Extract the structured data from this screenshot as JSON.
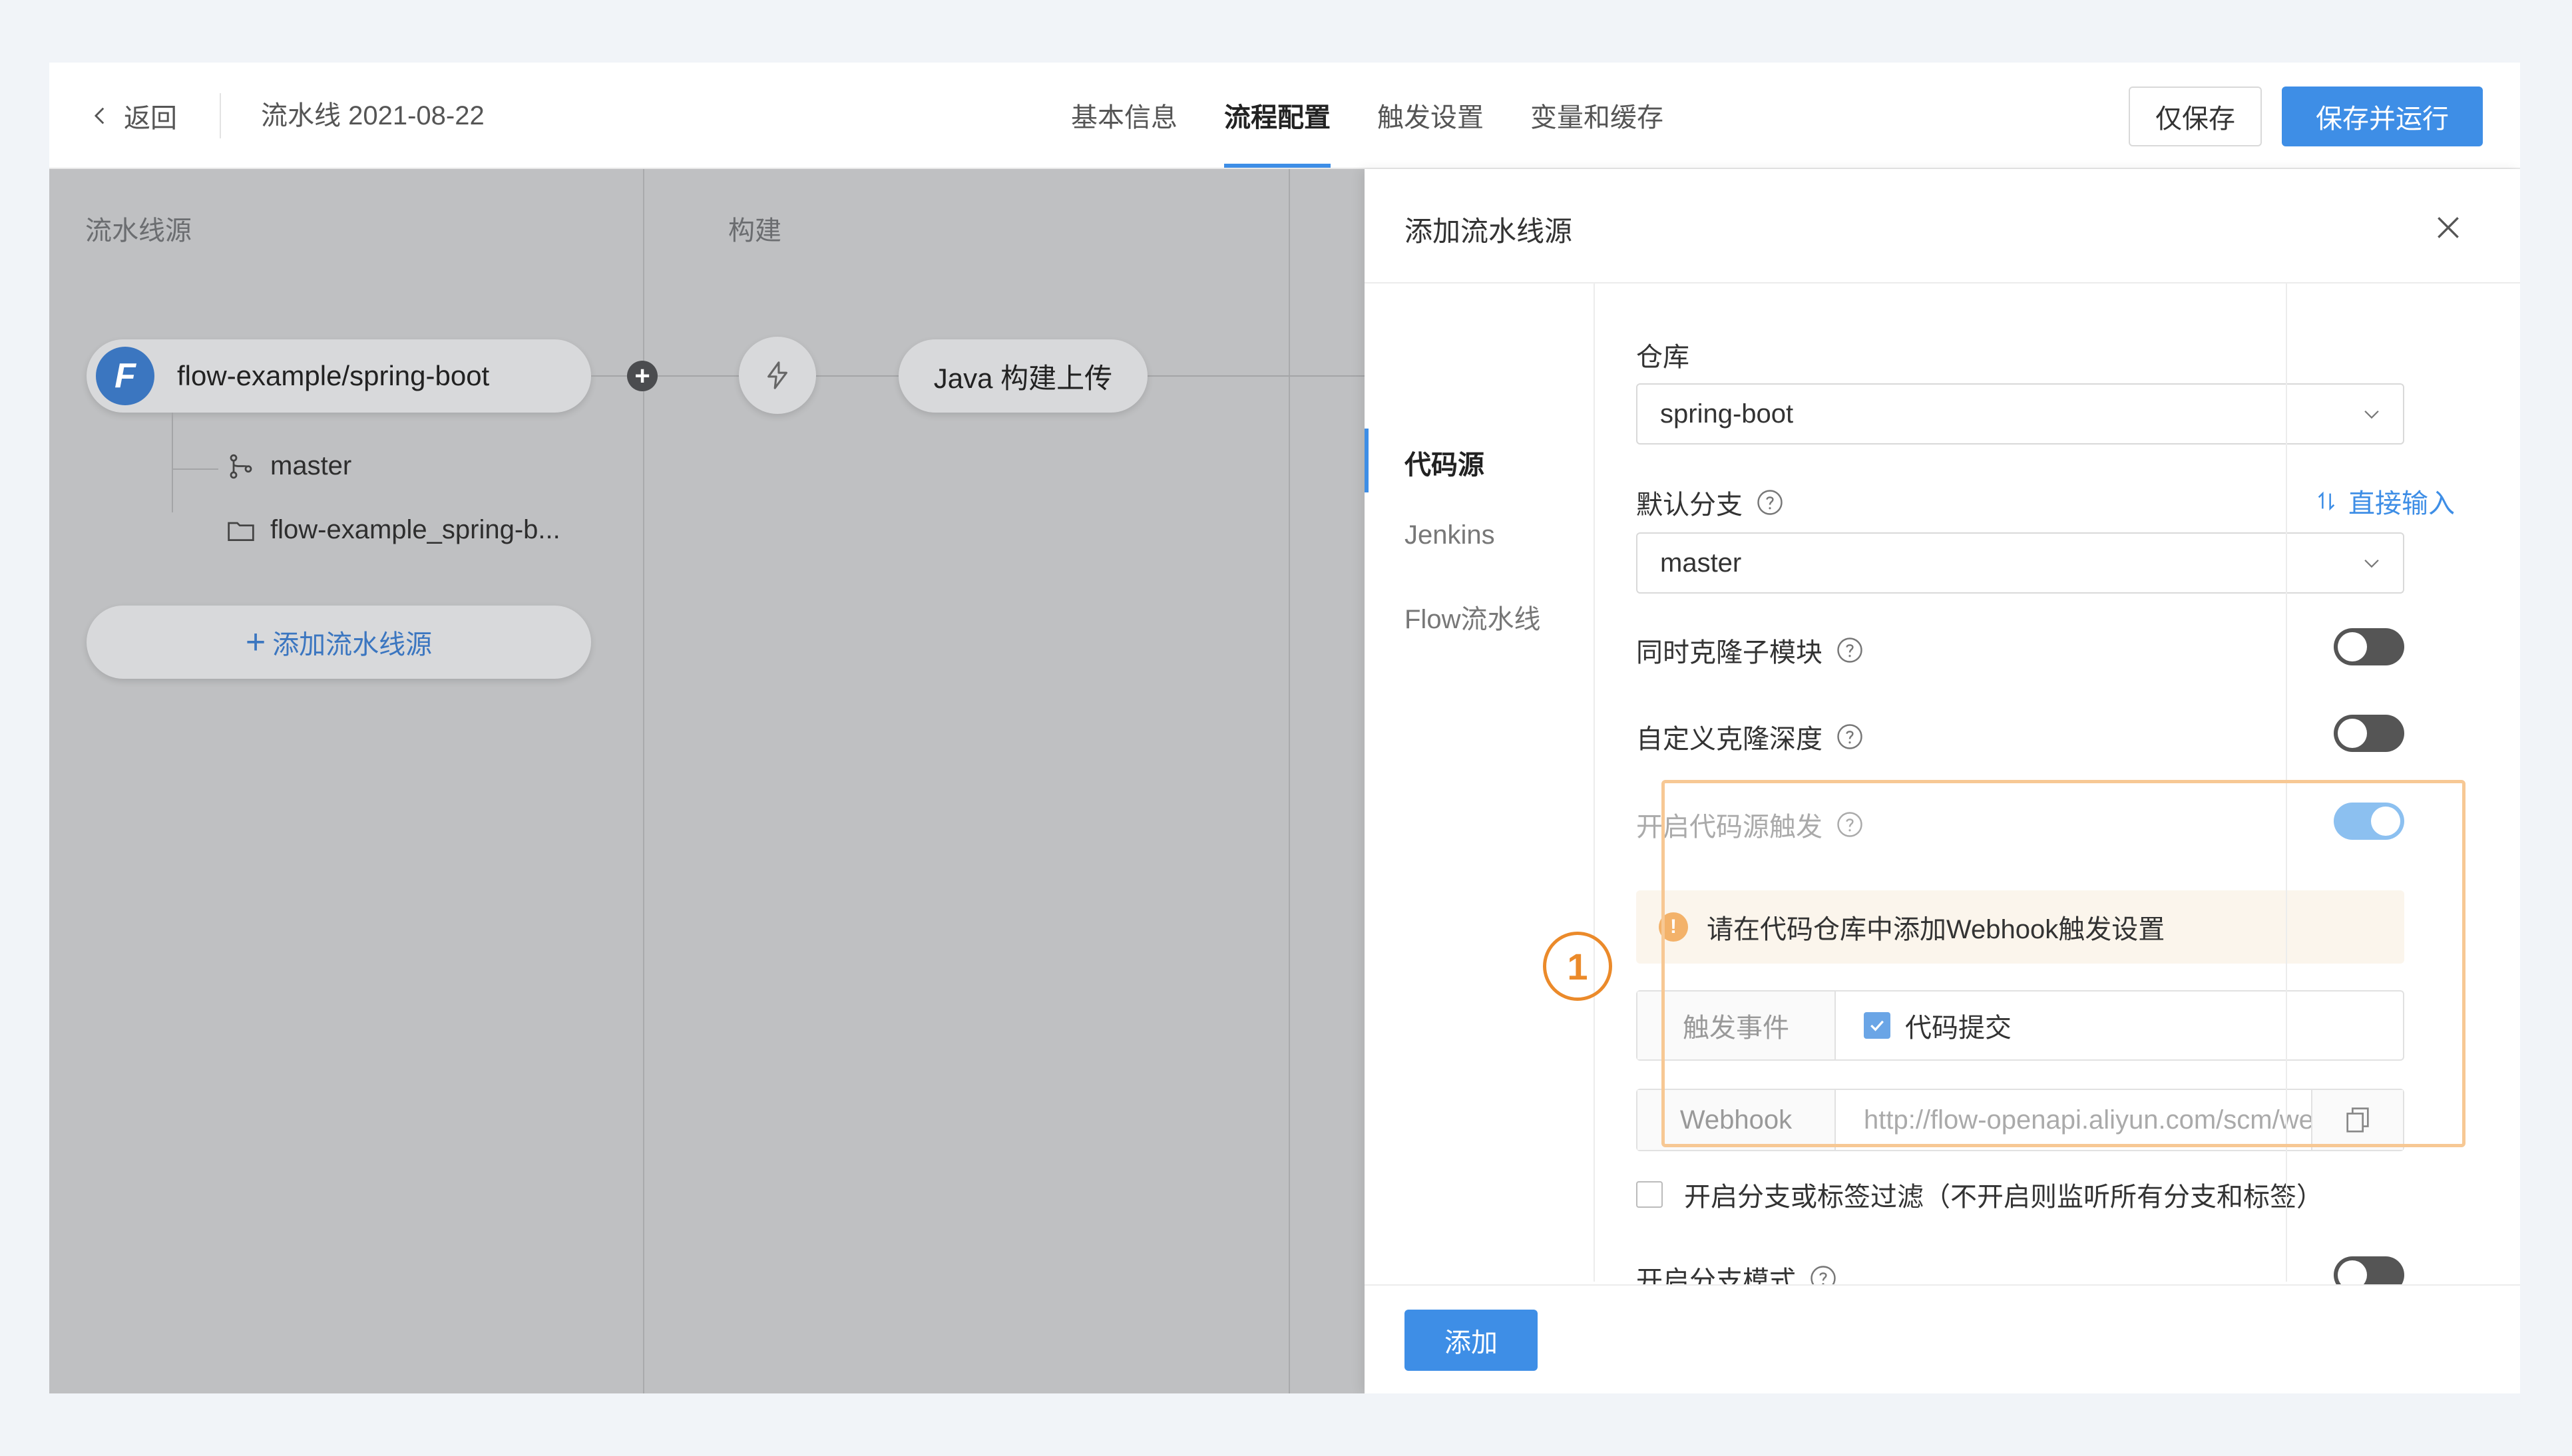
{
  "header": {
    "back_label": "返回",
    "pipeline_title": "流水线 2021-08-22",
    "tabs": [
      {
        "label": "基本信息",
        "active": false
      },
      {
        "label": "流程配置",
        "active": true
      },
      {
        "label": "触发设置",
        "active": false
      },
      {
        "label": "变量和缓存",
        "active": false
      }
    ],
    "save_only_label": "仅保存",
    "save_run_label": "保存并运行"
  },
  "canvas": {
    "columns": [
      "流水线源",
      "构建"
    ],
    "source": {
      "logo_letter": "F",
      "name": "flow-example/spring-boot",
      "branch": "master",
      "path": "flow-example_spring-b..."
    },
    "add_source_label": "添加流水线源",
    "add_source_plus": "+",
    "plus_dot": "+",
    "job_label": "Java 构建上传"
  },
  "drawer": {
    "title": "添加流水线源",
    "nav": [
      {
        "label": "代码源",
        "active": true
      },
      {
        "label": "Jenkins",
        "active": false
      },
      {
        "label": "Flow流水线",
        "active": false
      }
    ],
    "repo_label": "仓库",
    "repo_value": "spring-boot",
    "branch_label": "默认分支",
    "direct_input_label": "直接输入",
    "branch_value": "master",
    "clone_submodules_label": "同时克隆子模块",
    "clone_submodules_on": false,
    "custom_depth_label": "自定义克隆深度",
    "custom_depth_on": false,
    "source_trigger_label": "开启代码源触发",
    "source_trigger_on": true,
    "alert_text": "请在代码仓库中添加Webhook触发设置",
    "alert_icon": "!",
    "trigger_event_label": "触发事件",
    "trigger_event_option": "代码提交",
    "trigger_event_checked": true,
    "webhook_label": "Webhook",
    "webhook_value": "http://flow-openapi.aliyun.com/scm/webhook",
    "filter_label": "开启分支或标签过滤（不开启则监听所有分支和标签）",
    "filter_checked": false,
    "branch_mode_label": "开启分支模式",
    "branch_mode_on": false,
    "add_button_label": "添加"
  },
  "annotation": {
    "step_number": "1",
    "highlight_color": "#f7c894",
    "step_color": "#eb8a2a"
  },
  "colors": {
    "accent": "#3e8ee6",
    "canvas_bg": "#bfc0c2",
    "page_bg": "#f1f4f8"
  }
}
